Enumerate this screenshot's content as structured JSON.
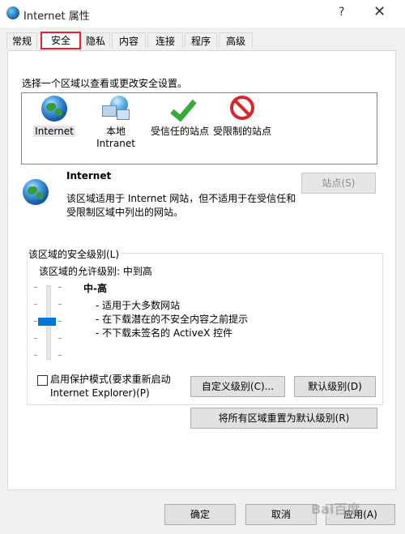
{
  "window": {
    "title": "Internet 属性",
    "help": "?",
    "close": "✕"
  },
  "tabs": [
    "常规",
    "安全",
    "隐私",
    "内容",
    "连接",
    "程序",
    "高级"
  ],
  "active_tab": "安全",
  "zones": {
    "prompt": "选择一个区域以查看或更改安全设置。",
    "items": [
      {
        "label_line1": "Internet",
        "label_line2": "",
        "icon": "globe-icon",
        "selected": true
      },
      {
        "label_line1": "本地",
        "label_line2": "Intranet",
        "icon": "intranet-icon",
        "selected": false
      },
      {
        "label_line1": "受信任的站点",
        "label_line2": "",
        "icon": "checkmark-icon",
        "selected": false
      },
      {
        "label_line1": "受限制的站点",
        "label_line2": "",
        "icon": "restricted-icon",
        "selected": false
      }
    ]
  },
  "zone_info": {
    "name": "Internet",
    "description": "该区域适用于 Internet 网站，但不适用于在受信任和受限制区域中列出的网站。",
    "sites_button": "站点(S)"
  },
  "security_level": {
    "group_title": "该区域的安全级别(L)",
    "allowed_text": "该区域的允许级别: 中到高",
    "level_name": "中-高",
    "bullets": [
      "- 适用于大多数网站",
      "- 在下载潜在的不安全内容之前提示",
      "- 不下载未签名的 ActiveX 控件"
    ],
    "protected_mode_line1": "启用保护模式(要求重新启动",
    "protected_mode_line2": "Internet Explorer)(P)",
    "protected_mode_checked": false,
    "custom_level_button": "自定义级别(C)...",
    "default_level_button": "默认级别(D)",
    "reset_all_button": "将所有区域重置为默认级别(R)"
  },
  "footer": {
    "ok": "确定",
    "cancel": "取消",
    "apply": "应用(A)"
  },
  "watermark": "Bai百度"
}
